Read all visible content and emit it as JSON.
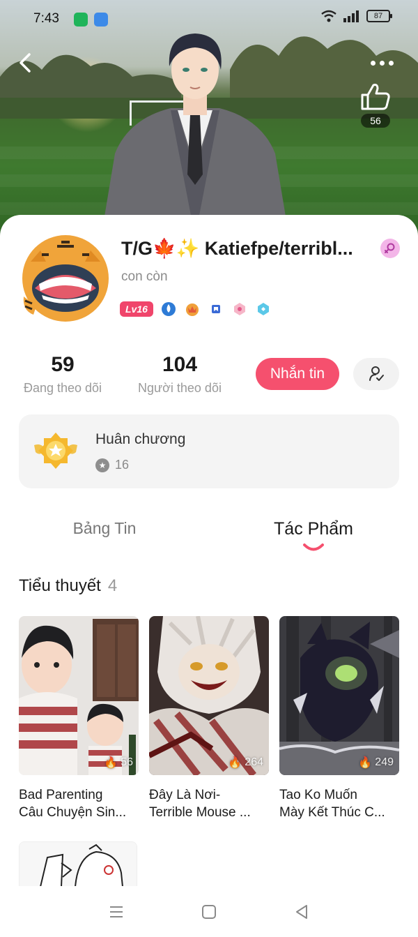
{
  "status_bar": {
    "time": "7:43",
    "battery": "87"
  },
  "hero": {
    "like_count": "56"
  },
  "profile": {
    "name": "T/G🍁✨ Katiefpe/terribl...",
    "bio": "con còn",
    "level": "Lv16",
    "following_count": "59",
    "following_label": "Đang theo dõi",
    "followers_count": "104",
    "followers_label": "Người theo dõi",
    "message_button": "Nhắn tin"
  },
  "medals": {
    "title": "Huân chương",
    "count": "16"
  },
  "tabs": [
    {
      "label": "Bảng Tin",
      "active": false
    },
    {
      "label": "Tác Phẩm",
      "active": true
    }
  ],
  "section": {
    "title": "Tiểu thuyết",
    "count": "4"
  },
  "novels": [
    {
      "title_line1": "Bad Parenting",
      "title_line2": "Câu Chuyện Sin...",
      "views": "56"
    },
    {
      "title_line1": "Đây Là Nơi-",
      "title_line2": "Terrible Mouse ...",
      "views": "264"
    },
    {
      "title_line1": "Tao Ko Muốn",
      "title_line2": "Mày Kết Thúc C...",
      "views": "249"
    }
  ],
  "colors": {
    "accent": "#f5506e",
    "level_badge": "#f0456b",
    "gender_badge": "#f3b6e8"
  },
  "icons": [
    "back-icon",
    "more-icon",
    "like-icon",
    "gender-icon",
    "follow-user-icon",
    "medal-icon",
    "star-icon",
    "fire-icon",
    "menu-icon",
    "home-icon",
    "back-nav-icon"
  ]
}
